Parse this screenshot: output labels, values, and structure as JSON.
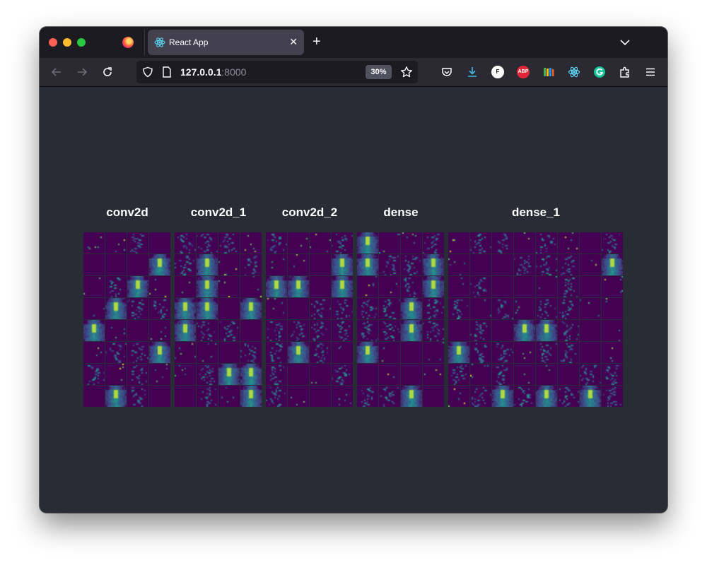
{
  "browser": {
    "tab": {
      "title": "React App"
    },
    "url": {
      "host": "127.0.0.1",
      "port": ":8000"
    },
    "zoom": "30%",
    "toolbar_icons": [
      "back-arrow-icon",
      "forward-arrow-icon",
      "reload-icon",
      "shield-icon",
      "page-icon",
      "star-icon",
      "pocket-icon",
      "download-icon",
      "extension-f-icon",
      "adblock-icon",
      "bookshelf-icon",
      "react-devtools-icon",
      "grammarly-icon",
      "puzzle-icon",
      "hamburger-menu-icon"
    ],
    "extensions": {
      "f": "F",
      "abp": "ABP"
    }
  },
  "colors": {
    "window_bg": "#282c34",
    "tabbar_bg": "#1c1b22",
    "navbar_bg": "#2b2a33",
    "viridis_low": "#440154",
    "viridis_mid": "#21918c",
    "viridis_high": "#fde725"
  },
  "layers": [
    {
      "name": "conv2d",
      "cols": 4,
      "rows": 8
    },
    {
      "name": "conv2d_1",
      "cols": 4,
      "rows": 8
    },
    {
      "name": "conv2d_2",
      "cols": 4,
      "rows": 8
    },
    {
      "name": "dense",
      "cols": 4,
      "rows": 8
    },
    {
      "name": "dense_1",
      "cols": 8,
      "rows": 8
    }
  ]
}
